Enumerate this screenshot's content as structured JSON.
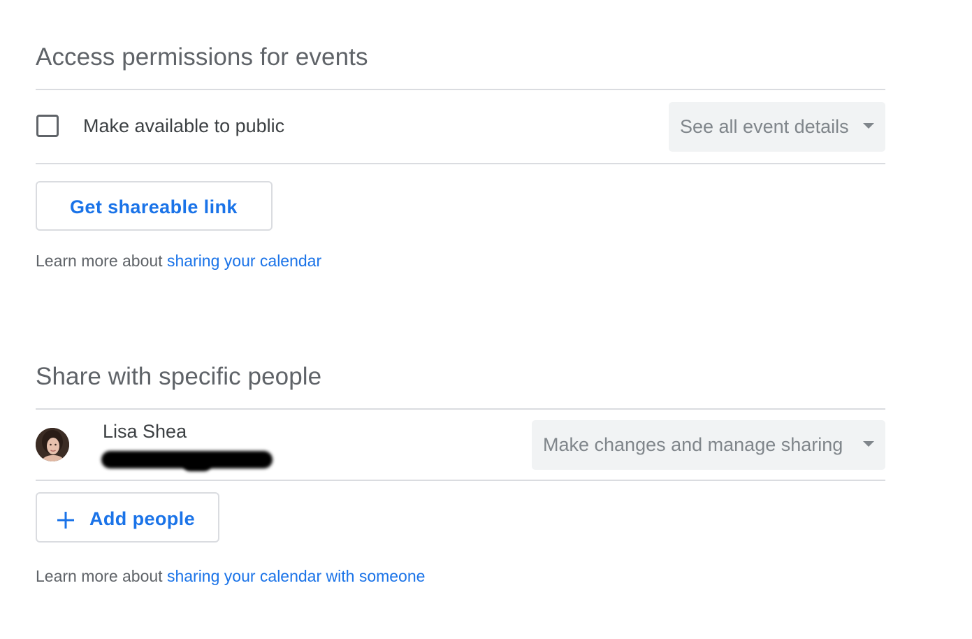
{
  "public_access": {
    "title": "Access permissions for events",
    "checkbox_label": "Make available to public",
    "checkbox_checked": false,
    "permission_select": "See all event details",
    "shareable_link_button": "Get shareable link",
    "help_prefix": "Learn more about ",
    "help_link": "sharing your calendar"
  },
  "specific_people": {
    "title": "Share with specific people",
    "people": [
      {
        "name": "Lisa Shea",
        "email_redacted": true,
        "permission_select": "Make changes and manage sharing"
      }
    ],
    "add_button": "Add people",
    "help_prefix": "Learn more about ",
    "help_link": "sharing your calendar with someone"
  },
  "icons": {
    "add": "plus-icon",
    "dropdown": "triangle-down-icon",
    "avatar": "user-avatar"
  },
  "colors": {
    "accent": "#1a73e8",
    "divider": "#dadce0",
    "select_bg": "#f1f3f4",
    "title": "#5f6368"
  }
}
